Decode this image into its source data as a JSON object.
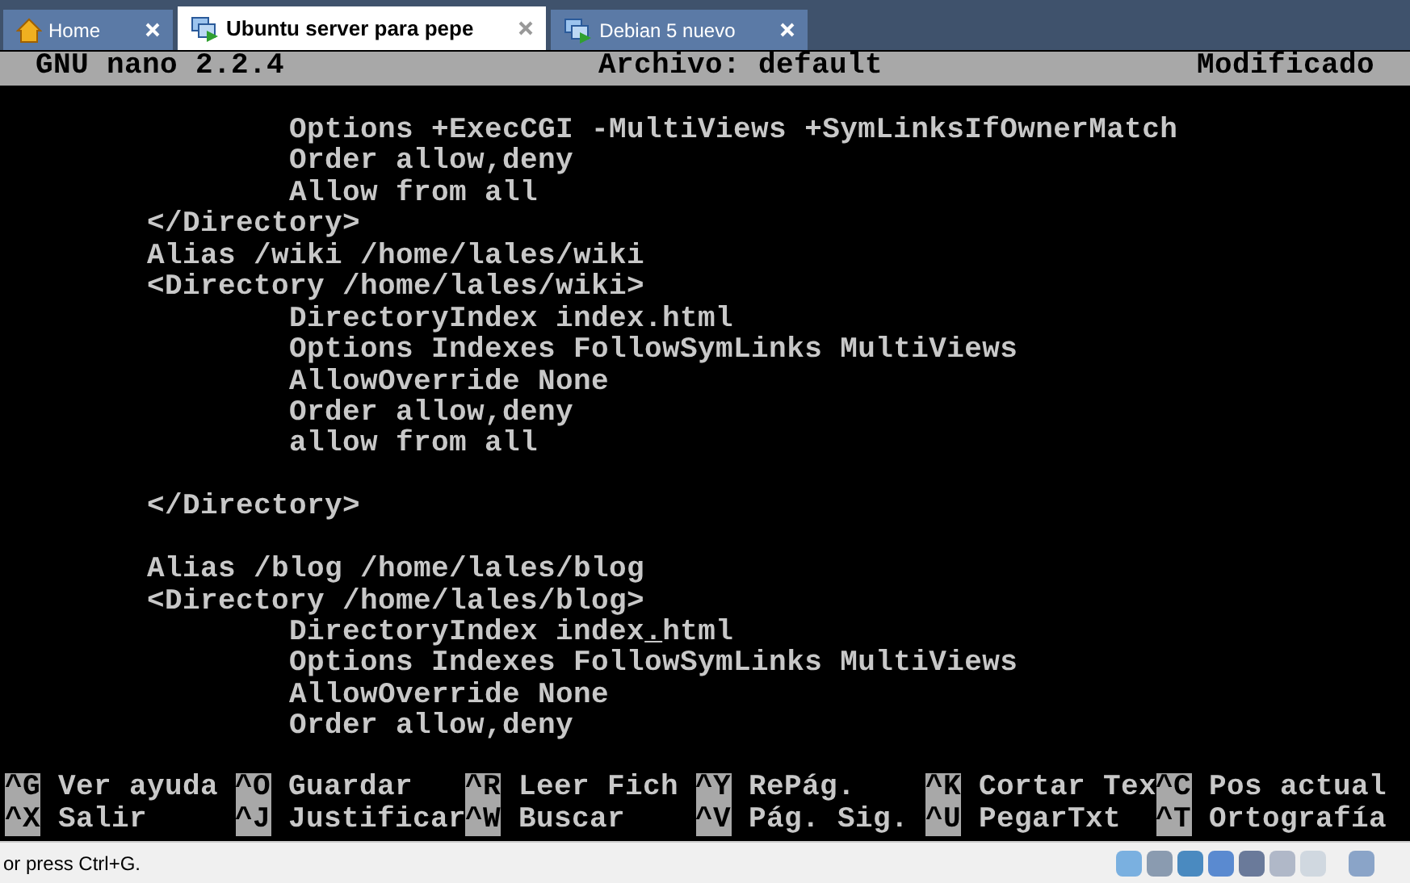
{
  "tabs": [
    {
      "label": "Home",
      "kind": "home",
      "selected": false
    },
    {
      "label": "Ubuntu server para pepe",
      "kind": "machine",
      "selected": true
    },
    {
      "label": "Debian 5 nuevo",
      "kind": "machine",
      "selected": false
    }
  ],
  "nano": {
    "version": "GNU nano 2.2.4",
    "file": "Archivo: default",
    "state": "Modificado"
  },
  "lines": [
    {
      "kind": "line",
      "text": "        Options +ExecCGI -MultiViews +SymLinksIfOwnerMatch"
    },
    {
      "kind": "line",
      "text": "        Order allow,deny"
    },
    {
      "kind": "line",
      "text": "        Allow from all"
    },
    {
      "kind": "line",
      "text": "</Directory>"
    },
    {
      "kind": "line",
      "text": "Alias /wiki /home/lales/wiki"
    },
    {
      "kind": "line",
      "text": "<Directory /home/lales/wiki>"
    },
    {
      "kind": "line",
      "text": "        DirectoryIndex index.html"
    },
    {
      "kind": "line",
      "text": "        Options Indexes FollowSymLinks MultiViews"
    },
    {
      "kind": "line",
      "text": "        AllowOverride None"
    },
    {
      "kind": "line",
      "text": "        Order allow,deny"
    },
    {
      "kind": "line",
      "text": "        allow from all"
    },
    {
      "kind": "blank"
    },
    {
      "kind": "line",
      "text": "</Directory>"
    },
    {
      "kind": "blank"
    },
    {
      "kind": "line",
      "text": "Alias /blog /home/lales/blog"
    },
    {
      "kind": "line",
      "text": "<Directory /home/lales/blog>"
    },
    {
      "kind": "cursor",
      "before": "        DirectoryIndex index",
      "at": ".",
      "after": "html"
    },
    {
      "kind": "line",
      "text": "        Options Indexes FollowSymLinks MultiViews"
    },
    {
      "kind": "line",
      "text": "        AllowOverride None"
    },
    {
      "kind": "line",
      "text": "        Order allow,deny"
    }
  ],
  "shortcuts": [
    [
      {
        "key": "^G",
        "label": "Ver ayuda"
      },
      {
        "key": "^O",
        "label": "Guardar"
      },
      {
        "key": "^R",
        "label": "Leer Fich"
      },
      {
        "key": "^Y",
        "label": "RePág."
      },
      {
        "key": "^K",
        "label": "Cortar Tex"
      },
      {
        "key": "^C",
        "label": "Pos actual"
      }
    ],
    [
      {
        "key": "^X",
        "label": "Salir"
      },
      {
        "key": "^J",
        "label": "Justificar"
      },
      {
        "key": "^W",
        "label": "Buscar"
      },
      {
        "key": "^V",
        "label": "Pág. Sig."
      },
      {
        "key": "^U",
        "label": "PegarTxt"
      },
      {
        "key": "^T",
        "label": "Ortografía"
      }
    ]
  ],
  "status_bar": {
    "text": "or press Ctrl+G."
  }
}
